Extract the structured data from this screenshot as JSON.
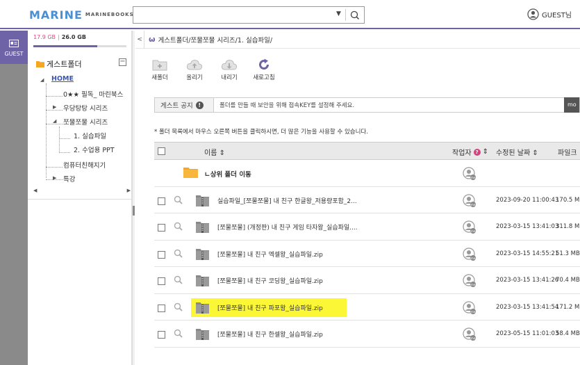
{
  "header": {
    "logo_main": "MARINE",
    "logo_sub": "MARINEBOOKS",
    "search_placeholder": "",
    "user_label": "GUEST님"
  },
  "leftbar": {
    "guest_label": "GUEST"
  },
  "tree": {
    "quota_used": "17.9 GB",
    "quota_total": "26.0 GB",
    "quota_fraction": 0.69,
    "root_label": "게스트폴더",
    "items": [
      {
        "label": "HOME"
      },
      {
        "label": "0★★ 필독_ 마린북스"
      },
      {
        "label": "우당탕탕 시리즈"
      },
      {
        "label": "쪼물쪼물 시리즈"
      },
      {
        "label": "1. 실습파일"
      },
      {
        "label": "2. 수업용 PPT"
      },
      {
        "label": "컴퓨터친해지기"
      },
      {
        "label": "특강"
      }
    ]
  },
  "main": {
    "breadcrumb": "게스트폴더/쪼물쪼물 시리즈/1. 실습파일/",
    "toolbar": [
      {
        "label": "새폴더",
        "icon": "new-folder-icon"
      },
      {
        "label": "올리기",
        "icon": "upload-icon"
      },
      {
        "label": "내리기",
        "icon": "download-icon"
      },
      {
        "label": "새로고침",
        "icon": "refresh-icon"
      }
    ],
    "notice_label": "게스트 공지",
    "notice_text": "폴더를 만들 때 보안을 위해 접속KEY를 설정해 주세요.",
    "notice_btn": "mo",
    "hint": "* 폴더 목록에서 마우스 오른쪽 버튼을 클릭하시면, 더 많은 기능을 사용할 수 있습니다.",
    "columns": {
      "name": "이름 ⇕",
      "author": "작업자",
      "date": "수정된 날짜 ⇕",
      "size": "파일크"
    },
    "up_label": "ㄴ상위 폴더 이동",
    "files": [
      {
        "name": "실습파일_[쪼물쪼물] 내 친구 한글왕_저용량포함_2...",
        "date": "2023-09-20 11:00:43",
        "size": "170.5 M"
      },
      {
        "name": "[쪼물쪼물] (개정판) 내 친구 게임 타자왕_실습파일....",
        "date": "2023-03-15 13:41:03",
        "size": "311.8 M"
      },
      {
        "name": "[쪼물쪼물] 내 친구 엑셀왕_실습파일.zip",
        "date": "2023-03-15 14:55:21",
        "size": "51.3 MB"
      },
      {
        "name": "[쪼물쪼물] 내 친구 코딩왕_실습파일.zip",
        "date": "2023-03-15 13:41:26",
        "size": "70.4 MB"
      },
      {
        "name": "[쪼물쪼물] 내 친구 파포왕_실습파일.zip",
        "date": "2023-03-15 13:41:54",
        "size": "171.2 M",
        "highlight": true
      },
      {
        "name": "[쪼물쪼물] 내 친구 한셀왕_실습파일.zip",
        "date": "2023-05-15 11:01:03",
        "size": "58.4 MB"
      }
    ]
  }
}
